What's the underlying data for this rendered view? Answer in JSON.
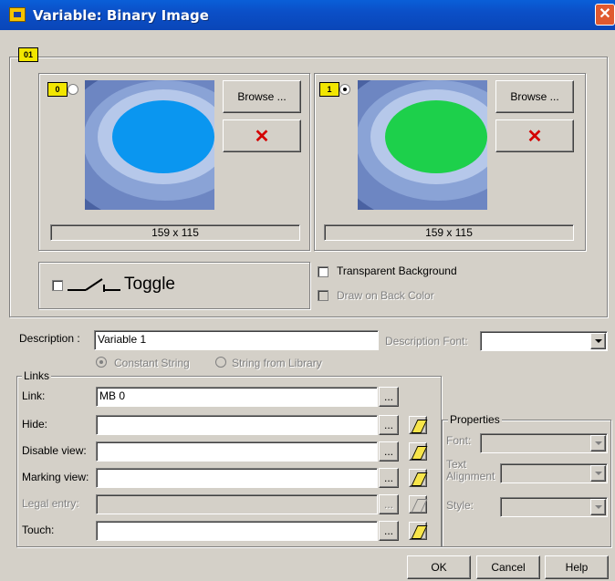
{
  "window": {
    "title": "Variable: Binary Image",
    "close_glyph": "✕"
  },
  "states": {
    "state0": {
      "badge": "0",
      "image_size": "159 x 115",
      "browse_label": "Browse ...",
      "delete_glyph": "✕",
      "fill_color": "#0a96f0",
      "selected": false
    },
    "state1": {
      "badge": "1",
      "image_size": "159 x 115",
      "browse_label": "Browse ...",
      "delete_glyph": "✕",
      "fill_color": "#1dd04b",
      "selected": true
    },
    "group_badge": "01"
  },
  "toggle": {
    "label": "Toggle",
    "checked": false
  },
  "options": {
    "transparent_background": {
      "label": "Transparent Background",
      "checked": false
    },
    "draw_on_back_color": {
      "label": "Draw on Back Color",
      "checked": false,
      "enabled": false
    }
  },
  "description": {
    "label": "Description :",
    "value": "Variable 1",
    "font_label": "Description Font:",
    "font_value": "",
    "constant_string": "Constant String",
    "string_from_library": "String from Library"
  },
  "links": {
    "legend": "Links",
    "rows": [
      {
        "label": "Link:",
        "value": "MB 0",
        "ellipsis": "...",
        "has_eraser": false,
        "enabled": true
      },
      {
        "label": "Hide:",
        "value": "",
        "ellipsis": "...",
        "has_eraser": true,
        "enabled": true
      },
      {
        "label": "Disable view:",
        "value": "",
        "ellipsis": "...",
        "has_eraser": true,
        "enabled": true
      },
      {
        "label": "Marking view:",
        "value": "",
        "ellipsis": "...",
        "has_eraser": true,
        "enabled": true
      },
      {
        "label": "Legal entry:",
        "value": "",
        "ellipsis": "...",
        "has_eraser": true,
        "enabled": false
      },
      {
        "label": "Touch:",
        "value": "",
        "ellipsis": "...",
        "has_eraser": true,
        "enabled": true
      }
    ]
  },
  "properties": {
    "legend": "Properties",
    "font_label": "Font:",
    "text_alignment_line1": "Text",
    "text_alignment_line2": "Alignment",
    "style_label": "Style:"
  },
  "footer": {
    "ok": "OK",
    "cancel": "Cancel",
    "help": "Help"
  }
}
